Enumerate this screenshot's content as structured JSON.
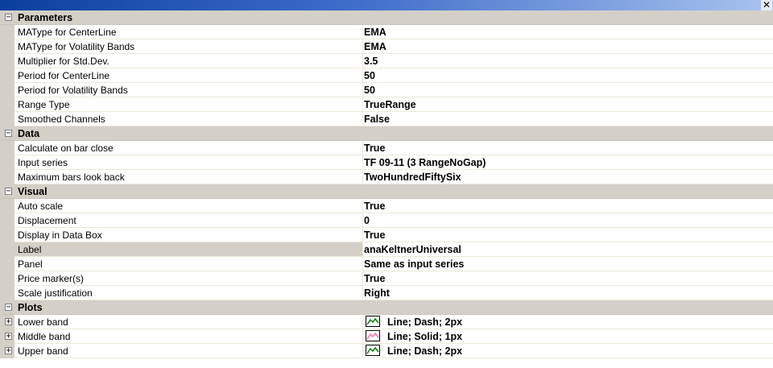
{
  "window": {
    "close_glyph": "✕"
  },
  "categories": [
    {
      "name": "Parameters",
      "expander": "−",
      "props": [
        {
          "name": "MAType for CenterLine",
          "value": "EMA"
        },
        {
          "name": "MAType for Volatility Bands",
          "value": "EMA"
        },
        {
          "name": "Multiplier for Std.Dev.",
          "value": "3.5"
        },
        {
          "name": "Period for CenterLine",
          "value": "50"
        },
        {
          "name": "Period for Volatility Bands",
          "value": "50"
        },
        {
          "name": "Range Type",
          "value": "TrueRange"
        },
        {
          "name": "Smoothed Channels",
          "value": "False"
        }
      ]
    },
    {
      "name": "Data",
      "expander": "−",
      "props": [
        {
          "name": "Calculate on bar close",
          "value": "True"
        },
        {
          "name": "Input series",
          "value": "TF 09-11 (3 RangeNoGap)"
        },
        {
          "name": "Maximum bars look back",
          "value": "TwoHundredFiftySix"
        }
      ]
    },
    {
      "name": "Visual",
      "expander": "−",
      "props": [
        {
          "name": "Auto scale",
          "value": "True"
        },
        {
          "name": "Displacement",
          "value": "0"
        },
        {
          "name": "Display in Data Box",
          "value": "True"
        },
        {
          "name": "Label",
          "value": "anaKeltnerUniversal",
          "selected": true
        },
        {
          "name": "Panel",
          "value": "Same as input series"
        },
        {
          "name": "Price marker(s)",
          "value": "True"
        },
        {
          "name": "Scale justification",
          "value": "Right"
        }
      ]
    },
    {
      "name": "Plots",
      "expander": "−",
      "props": [
        {
          "name": "Lower band",
          "value": "Line; Dash; 2px",
          "expander": "+",
          "icon": "plot-line-icon",
          "color": "#008000"
        },
        {
          "name": "Middle band",
          "value": "Line; Solid; 1px",
          "expander": "+",
          "icon": "plot-line-icon",
          "color": "#ff69b4"
        },
        {
          "name": "Upper band",
          "value": "Line; Dash; 2px",
          "expander": "+",
          "icon": "plot-line-icon",
          "color": "#008000"
        }
      ]
    }
  ]
}
